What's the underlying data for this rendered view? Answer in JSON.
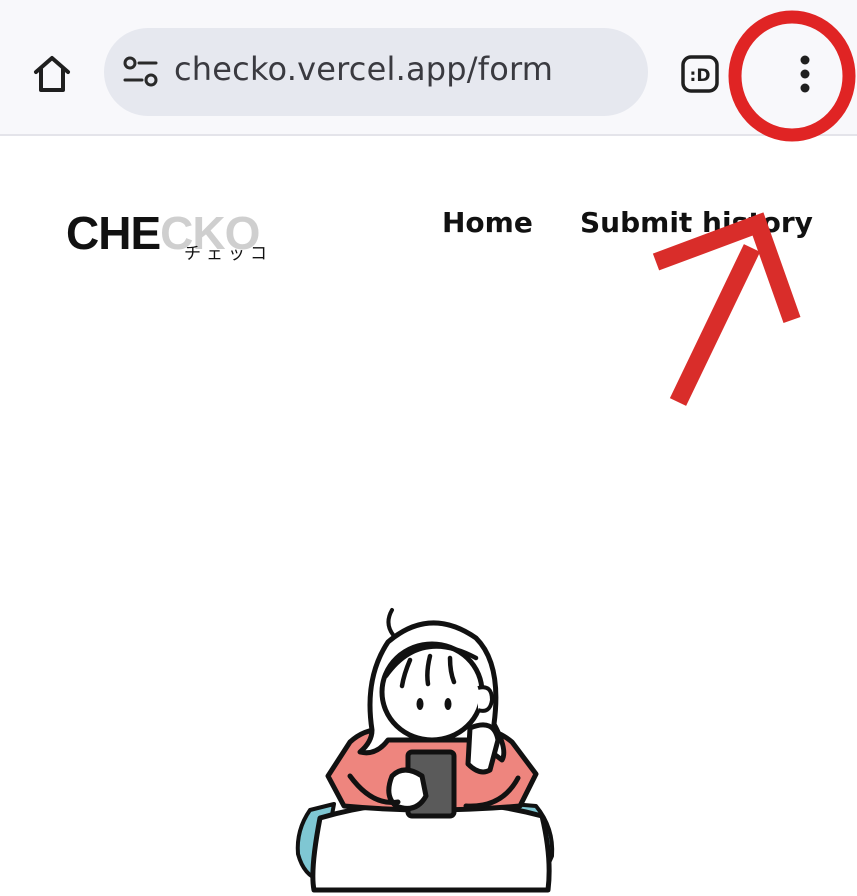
{
  "browser": {
    "url": "checko.vercel.app/form",
    "icons": {
      "home": "home-icon",
      "site_info": "tune-icon",
      "reader": "reader-mode-icon",
      "menu": "more-vert-icon"
    }
  },
  "site": {
    "logo_main_dark": "CHE",
    "logo_main_light": "CKO",
    "logo_sub": "チェッコ",
    "nav": {
      "home": "Home",
      "submit_history": "Submit history"
    }
  },
  "annotations": {
    "circle_color": "#e02424",
    "arrow_color": "#d92d2a"
  },
  "illustration": {
    "name": "girl-with-phone-illustration",
    "shirt_color": "#ee857e",
    "phone_color": "#5a5a5a",
    "frill_color": "#7fc7d3"
  }
}
